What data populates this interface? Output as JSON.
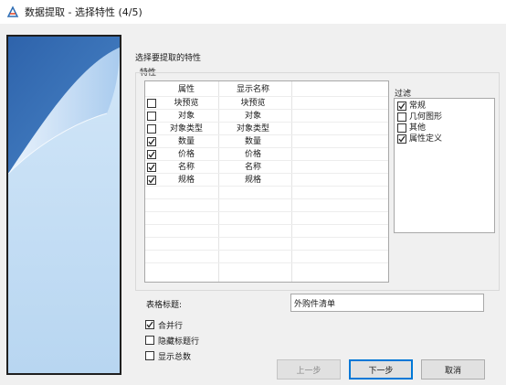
{
  "window": {
    "title": "数据提取 - 选择特性 (4/5)"
  },
  "heading": "选择要提取的特性",
  "properties_group": {
    "label": "特性",
    "columns": {
      "name": "属性",
      "display": "显示名称"
    },
    "rows": [
      {
        "name": "块预览",
        "display": "块预览",
        "checked": false
      },
      {
        "name": "对象",
        "display": "对象",
        "checked": false
      },
      {
        "name": "对象类型",
        "display": "对象类型",
        "checked": false
      },
      {
        "name": "数量",
        "display": "数量",
        "checked": true
      },
      {
        "name": "价格",
        "display": "价格",
        "checked": true
      },
      {
        "name": "名称",
        "display": "名称",
        "checked": true
      },
      {
        "name": "规格",
        "display": "规格",
        "checked": true
      }
    ]
  },
  "filter": {
    "label": "过滤",
    "items": [
      {
        "label": "常规",
        "checked": true
      },
      {
        "label": "几何图形",
        "checked": false
      },
      {
        "label": "其他",
        "checked": false
      },
      {
        "label": "属性定义",
        "checked": true
      }
    ]
  },
  "table_title": {
    "label": "表格标题:",
    "value": "外购件清单"
  },
  "options": [
    {
      "label": "合并行",
      "checked": true
    },
    {
      "label": "隐藏标题行",
      "checked": false
    },
    {
      "label": "显示总数",
      "checked": false
    }
  ],
  "buttons": {
    "back": "上一步",
    "next": "下一步",
    "cancel": "取消"
  },
  "colors": {
    "accent": "#0078d7",
    "panel_blue": "#2e6db4",
    "panel_light": "#bcd8f2"
  }
}
